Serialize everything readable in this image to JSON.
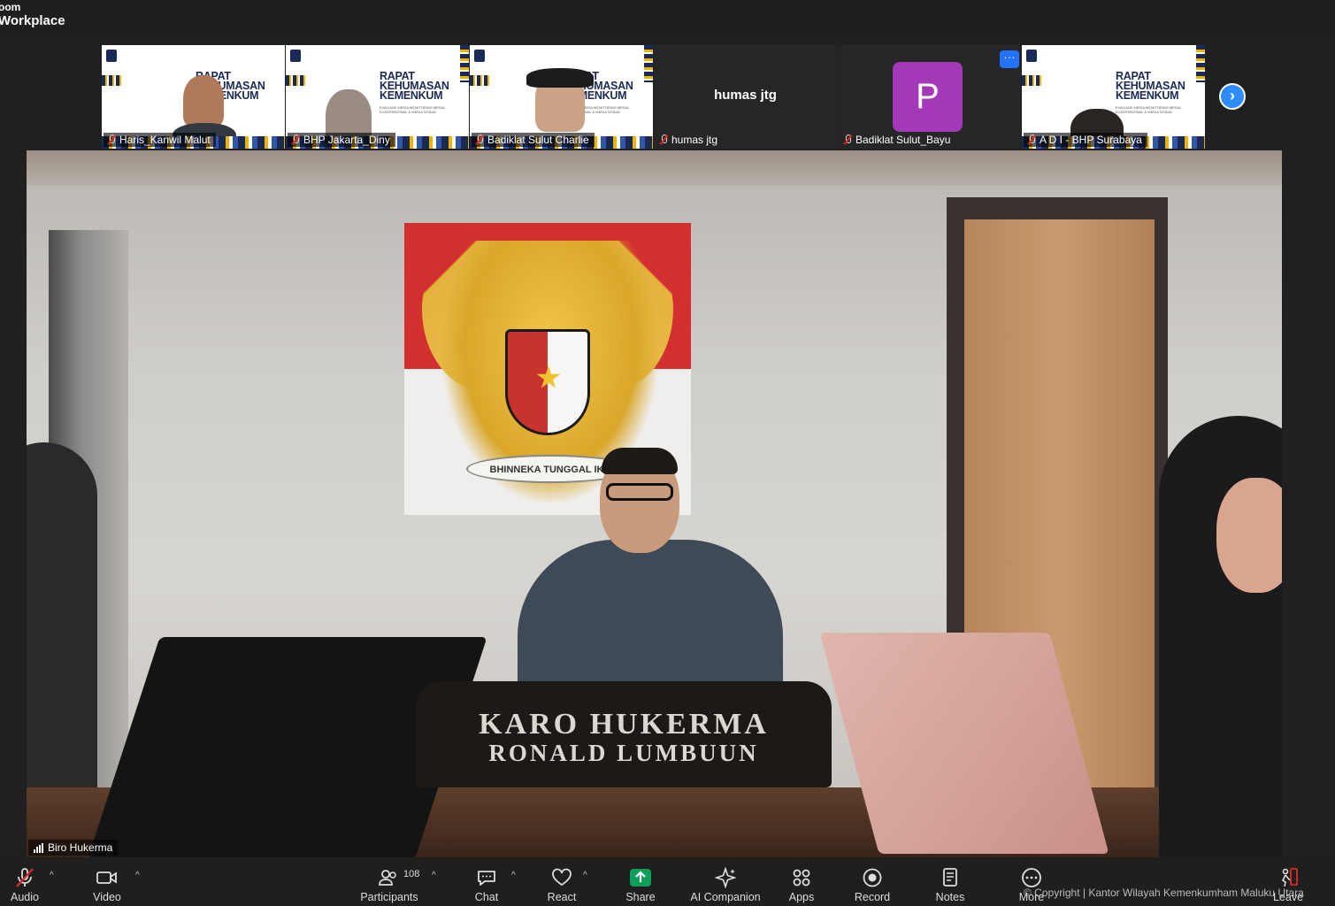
{
  "app": {
    "logo_line1": "oom",
    "logo_line2": "Workplace"
  },
  "slide": {
    "title": "RAPAT KEHUMASAN KEMENKUM",
    "subtitle": "EVALUASI MEDIA MONITORING MEDIA KONVENSIONAL & MEDIA SOSIAL"
  },
  "gallery": {
    "tiles": [
      {
        "name": "Haris_Kanwil Malut",
        "type": "video"
      },
      {
        "name": "BHP Jakarta_Diny",
        "type": "video"
      },
      {
        "name": "Badiklat Sulut Charlie",
        "type": "video"
      },
      {
        "name": "humas jtg",
        "display_name": "humas jtg",
        "type": "no-video"
      },
      {
        "name": "Badiklat Sulut_Bayu",
        "avatar_letter": "P",
        "avatar_color": "#a338b8",
        "type": "avatar"
      },
      {
        "name": "A D I  -  BHP Surabaya",
        "type": "video"
      }
    ],
    "more_label": "···",
    "next_icon": "chevron-right-icon"
  },
  "main": {
    "speaker_name": "Biro Hukerma",
    "nameplate_line1": "KARO HUKERMA",
    "nameplate_line2": "RONALD LUMBUUN",
    "motto": "BHINNEKA TUNGGAL IKA"
  },
  "toolbar": {
    "audio": "Audio",
    "video": "Video",
    "participants": "Participants",
    "participants_count": "108",
    "chat": "Chat",
    "react": "React",
    "share": "Share",
    "ai_companion": "AI Companion",
    "apps": "Apps",
    "record": "Record",
    "notes": "Notes",
    "more": "More",
    "leave": "Leave"
  },
  "watermark": "© Copyright | Kantor Wilayah Kemenkumham Maluku Utara",
  "colors": {
    "accent": "#2d8cff",
    "share_green": "#0e9f5b",
    "avatar": "#a338b8",
    "mute_red": "#e02828"
  }
}
